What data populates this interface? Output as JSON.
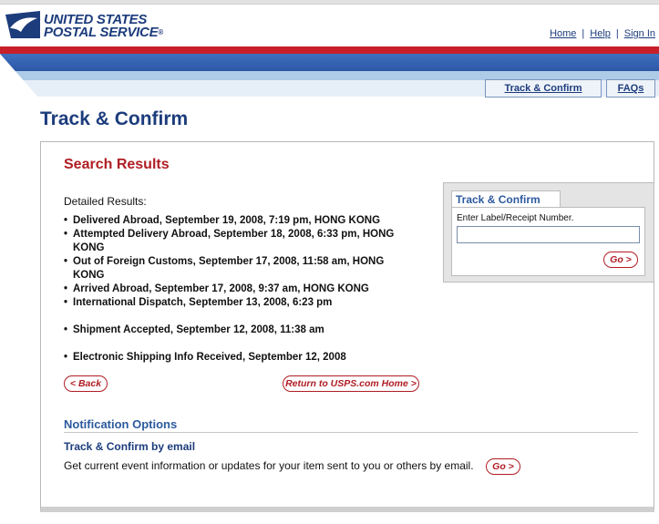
{
  "header": {
    "logo_line1": "UNITED STATES",
    "logo_line2": "POSTAL SERVICE",
    "logo_mark": "®",
    "links": [
      "Home",
      "Help",
      "Sign In"
    ],
    "link_separator": "|"
  },
  "subnav": [
    "Track & Confirm",
    "FAQs"
  ],
  "page_title": "Track & Confirm",
  "results": {
    "title": "Search Results",
    "detail_label": "Detailed Results:",
    "items": [
      "Delivered Abroad, September 19, 2008, 7:19 pm, HONG KONG",
      "Attempted Delivery Abroad, September 18, 2008, 6:33 pm, HONG KONG",
      "Out of Foreign Customs, September 17, 2008, 11:58 am, HONG KONG",
      "Arrived Abroad, September 17, 2008, 9:37 am, HONG KONG",
      "International Dispatch, September 13, 2008, 6:23 pm",
      "Shipment Accepted, September 12, 2008, 11:38 am",
      "Electronic Shipping Info Received, September 12, 2008"
    ],
    "back_label": "< Back",
    "home_label": "Return to USPS.com Home >"
  },
  "sidebox": {
    "title": "Track & Confirm",
    "label": "Enter Label/Receipt Number.",
    "input_value": "",
    "go_label": "Go >"
  },
  "notification": {
    "title": "Notification Options",
    "email_title": "Track & Confirm by email",
    "description": "Get current event information or updates for your item sent to you or others by email.",
    "go_label": "Go >"
  },
  "colors": {
    "brand_blue": "#1c3c7c",
    "brand_red": "#c8202a",
    "heading_red": "#b01d24"
  }
}
